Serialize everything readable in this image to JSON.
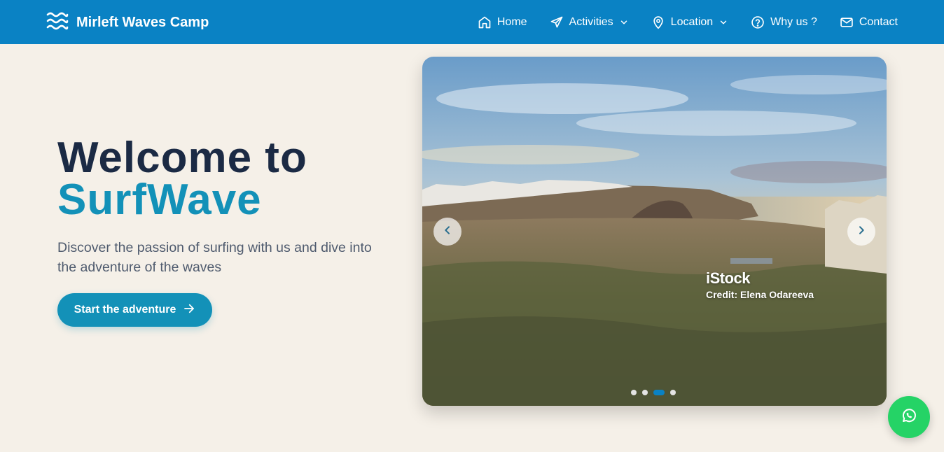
{
  "navbar": {
    "brand_name": "Mirleft Waves Camp",
    "brand_icon": "waves-icon",
    "bg_color": "#0a82c4",
    "items": [
      {
        "label": "Home",
        "icon": "home-icon"
      },
      {
        "label": "Activities",
        "icon": "plane-icon",
        "dropdown": true
      },
      {
        "label": "Location",
        "icon": "map-pin-icon",
        "dropdown": true
      },
      {
        "label": "Why us ?",
        "icon": "help-circle-icon"
      },
      {
        "label": "Contact",
        "icon": "mail-icon"
      }
    ]
  },
  "hero": {
    "title_line1": "Welcome to",
    "title_line2": "SurfWave",
    "subtitle": "Discover the passion of surfing with us and dive into the adventure of the waves",
    "cta_label": "Start the adventure",
    "title_color": "#1b2a44",
    "accent_color": "#1391b8",
    "bg_color": "#f5f0e8"
  },
  "carousel": {
    "watermark_brand": "iStock",
    "watermark_credit": "Credit: Elena Odareeva",
    "slide_count": 4,
    "active_index": 2
  },
  "whatsapp": {
    "icon": "whatsapp-icon",
    "color": "#25d366"
  }
}
